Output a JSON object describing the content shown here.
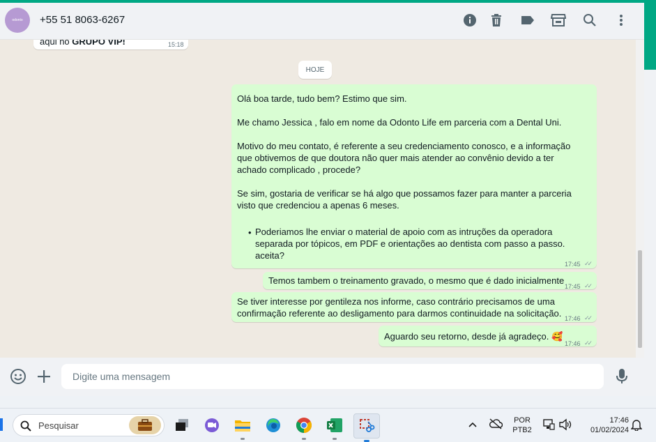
{
  "chat_header": {
    "avatar_text": "odonto",
    "contact_name": "+55 51 8063-6267",
    "icons": [
      "info-icon",
      "trash-icon",
      "label-icon",
      "store-icon",
      "search-icon",
      "more-icon"
    ]
  },
  "previous_message": {
    "text_prefix": "aqui no ",
    "text_bold": "GRUPO VIP!",
    "time": "15:18"
  },
  "date_chip": "HOJE",
  "messages": [
    {
      "paragraphs": [
        "Olá boa tarde, tudo bem? Estimo que sim.",
        "Me chamo Jessica , falo em nome da Odonto Life em parceria com a Dental Uni.",
        "Motivo do meu contato, é referente a seu credenciamento conosco, e a informação que obtivemos de que doutora não quer mais atender ao convênio devido a ter achado complicado , procede?",
        "Se sim, gostaria de verificar se há algo que possamos fazer para manter a parceria visto que credenciou a apenas 6 meses."
      ],
      "bullet": "Poderiamos lhe enviar o material de apoio com as intruções da operadora separada por tópicos, em PDF e orientações ao dentista com passo a passo. aceita?",
      "time": "17:45"
    },
    {
      "text": "Temos tambem o treinamento gravado, o mesmo que é dado inicialmente",
      "time": "17:45"
    },
    {
      "text": "Se tiver interesse por gentileza nos informe, caso contrário precisamos de uma confirmação referente ao desligamento para darmos continuidade na solicitação.",
      "time": "17:46"
    },
    {
      "text": "Aguardo seu retorno, desde já agradeço.",
      "emoji": "🥰",
      "time": "17:46"
    }
  ],
  "composer": {
    "placeholder": "Digite uma mensagem"
  },
  "taskbar": {
    "search_label": "Pesquisar",
    "apps": [
      "task-view",
      "teams",
      "file-explorer",
      "edge",
      "chrome",
      "excel",
      "snipping-tool"
    ],
    "tray": {
      "lang_top": "POR",
      "lang_bottom": "PTB2",
      "time": "17:46",
      "date": "01/02/2024"
    }
  }
}
